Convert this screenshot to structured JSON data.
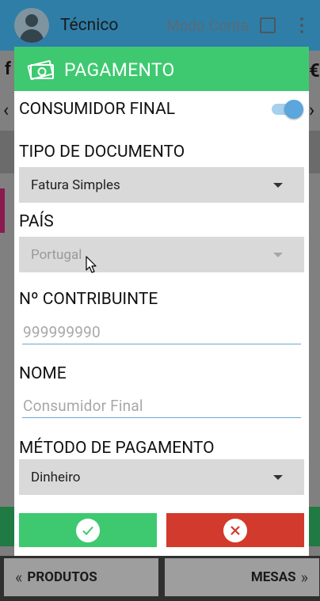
{
  "header": {
    "user_name": "Técnico",
    "mode_label": "Modo Conta",
    "mode_checked": false,
    "menu_icon": "kebab-menu-icon",
    "avatar_icon": "person-avatar-icon"
  },
  "background": {
    "left_glyph": "f",
    "right_glyph": "€"
  },
  "bottom_nav": {
    "produtos_label": "PRODUTOS",
    "mesas_label": "MESAS"
  },
  "dialog": {
    "title": "PAGAMENTO",
    "title_icon": "money-icon",
    "consumidor_final": {
      "label": "CONSUMIDOR FINAL",
      "on": true
    },
    "tipo_documento": {
      "label": "TIPO DE DOCUMENTO",
      "selected": "Fatura Simples"
    },
    "pais": {
      "label": "PAÍS",
      "selected": "Portugal",
      "disabled": true
    },
    "contribuinte": {
      "label": "Nº CONTRIBUINTE",
      "placeholder": "999999990"
    },
    "nome": {
      "label": "NOME",
      "placeholder": "Consumidor Final"
    },
    "metodo_pagamento": {
      "label": "MÉTODO DE PAGAMENTO",
      "selected": "Dinheiro"
    },
    "confirm_icon": "check-icon",
    "cancel_icon": "close-icon"
  },
  "colors": {
    "accent_green": "#3ec970",
    "cancel_red": "#d13a2c",
    "switch_blue": "#5aa6dd",
    "header_blue": "#2f7ea8"
  }
}
